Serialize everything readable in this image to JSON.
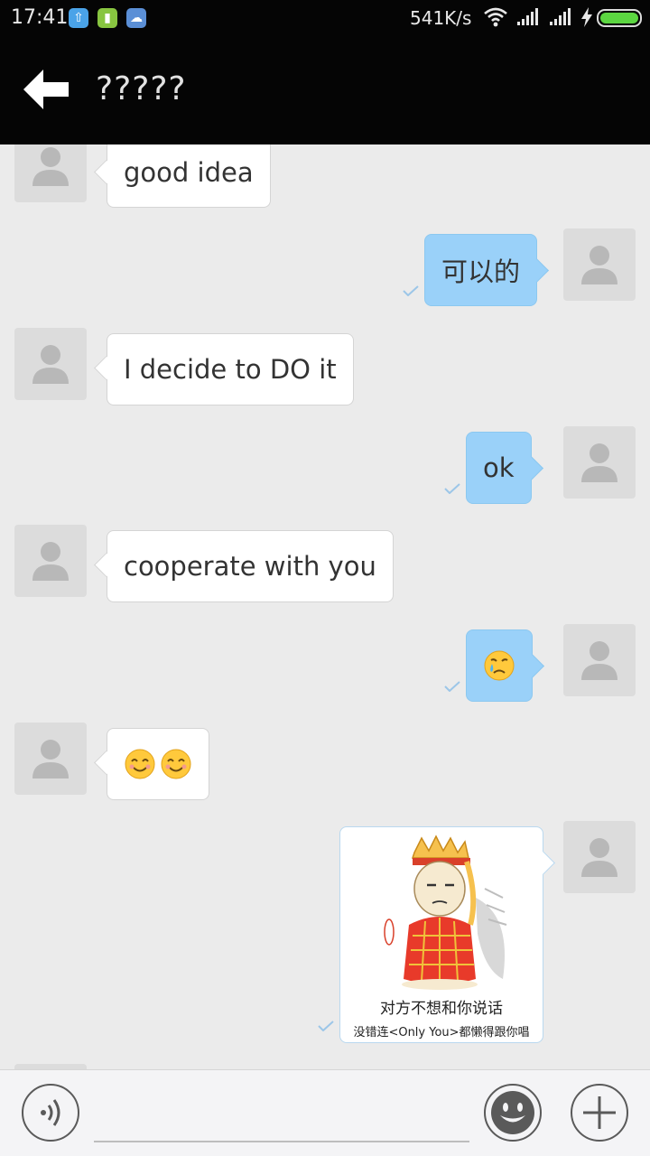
{
  "status_bar": {
    "time": "17:41",
    "net_speed": "541K/s",
    "icons": [
      "upload-icon",
      "battery-app-icon",
      "cloud-icon",
      "wifi-icon",
      "signal-icon",
      "signal-icon",
      "charging-icon",
      "battery-icon"
    ],
    "battery_color": "#5cd641"
  },
  "header": {
    "title": "?????",
    "back_icon": "arrow-left-icon"
  },
  "messages": [
    {
      "side": "in",
      "text": "good idea"
    },
    {
      "side": "out",
      "text": "可以的",
      "read": true
    },
    {
      "side": "in",
      "text": "I decide to DO it"
    },
    {
      "side": "out",
      "text": "ok",
      "read": true
    },
    {
      "side": "in",
      "text": "cooperate with you"
    },
    {
      "side": "out",
      "emoji": [
        "crying-face-icon"
      ],
      "read": true
    },
    {
      "side": "in",
      "emoji": [
        "smiling-face-icon",
        "smiling-face-icon"
      ]
    },
    {
      "side": "out",
      "sticker": {
        "line1": "对方不想和你说话",
        "line2": "没错连<Only You>都懒得跟你唱"
      },
      "read": true
    }
  ],
  "colors": {
    "outgoing_bubble": "#9ad1f9",
    "incoming_bubble": "#ffffff",
    "background": "#ebebeb",
    "header": "#050505"
  },
  "input_bar": {
    "text_value": "",
    "icons": [
      "voice-icon",
      "emoji-icon",
      "plus-icon"
    ]
  }
}
